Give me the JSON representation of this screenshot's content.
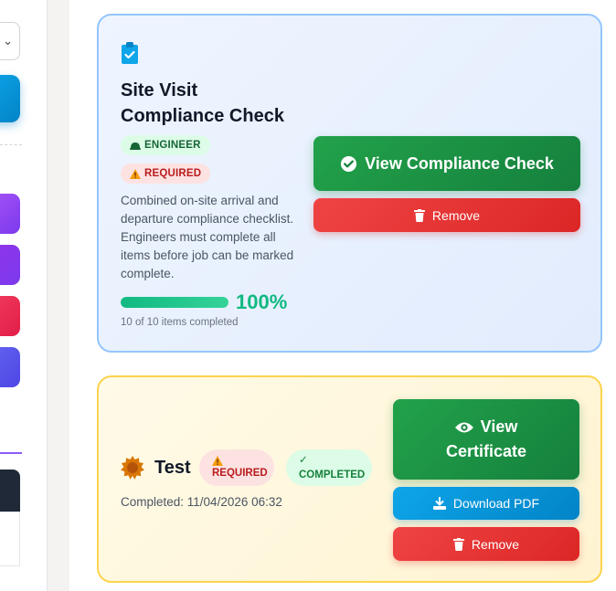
{
  "colors": {
    "accent_green": "#15803d",
    "danger_red": "#dc2626",
    "info_blue": "#0284c7",
    "progress_green": "#10b981"
  },
  "compliance_card": {
    "icon": "clipboard-check-icon",
    "title": "Site Visit Compliance Check",
    "role_badge": "ENGINEER",
    "role_badge_icon": "hard-hat-icon",
    "required_badge": "REQUIRED",
    "required_badge_icon": "warning-icon",
    "description": "Combined on-site arrival and departure compliance checklist. Engineers must complete all items before job can be marked complete.",
    "progress": {
      "percent_label": "100%",
      "fraction": 1.0,
      "summary": "10 of 10 items completed"
    },
    "view_button": "View Compliance Check",
    "view_button_icon": "check-circle-icon",
    "remove_button": "Remove",
    "remove_button_icon": "trash-icon"
  },
  "test_card": {
    "icon": "certificate-seal-icon",
    "title": "Test",
    "required_badge": "REQUIRED",
    "required_badge_icon": "warning-icon",
    "completed_badge": "COMPLETED",
    "completed_badge_icon": "check-icon",
    "completed_text": "Completed: 11/04/2026 06:32",
    "view_button_line1": "View",
    "view_button_line2": "Certificate",
    "view_button_icon": "eye-icon",
    "download_button": "Download PDF",
    "download_button_icon": "download-icon",
    "remove_button": "Remove",
    "remove_button_icon": "trash-icon"
  }
}
